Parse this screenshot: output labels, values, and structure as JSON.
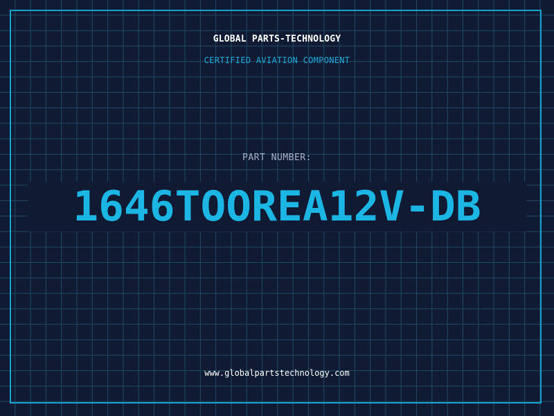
{
  "header": {
    "brand_name": "GLOBAL PARTS-TECHNOLOGY",
    "tagline": "CERTIFIED AVIATION COMPONENT"
  },
  "part": {
    "label": "PART NUMBER:",
    "number": "1646TOOREA12V-DB"
  },
  "footer": {
    "website": "www.globalpartstechnology.com"
  },
  "colors": {
    "background": "#101b33",
    "grid": "#1f4a63",
    "accent": "#1cb6e4",
    "frame": "#1aa3d0"
  }
}
